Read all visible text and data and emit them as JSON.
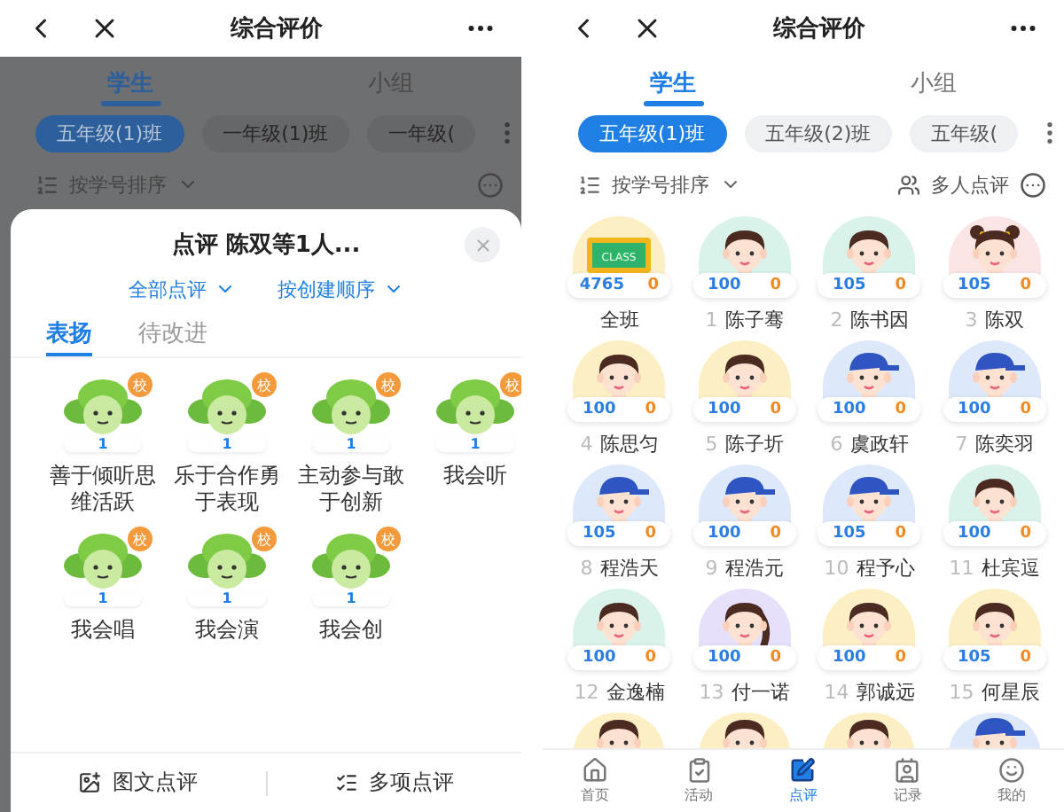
{
  "left_screen": {
    "title": "综合评价",
    "tabs": [
      {
        "label": "学生",
        "selected": true
      },
      {
        "label": "小组",
        "selected": false
      }
    ],
    "class_chips": [
      {
        "label": "五年级(1)班",
        "selected": true
      },
      {
        "label": "一年级(1)班",
        "selected": false
      },
      {
        "label": "一年级(",
        "selected": false
      }
    ],
    "sort_label": "按学号排序",
    "sheet": {
      "title": "点评 陈双等1人...",
      "filters": [
        "全部点评",
        "按创建顺序"
      ],
      "tabs": [
        {
          "label": "表扬",
          "selected": true
        },
        {
          "label": "待改进",
          "selected": false
        }
      ],
      "items": [
        {
          "label": "善于倾听思维活跃",
          "badge": "校",
          "count": "1"
        },
        {
          "label": "乐于合作勇于表现",
          "badge": "校",
          "count": "1"
        },
        {
          "label": "主动参与敢于创新",
          "badge": "校",
          "count": "1"
        },
        {
          "label": "我会听",
          "badge": "校",
          "count": "1"
        },
        {
          "label": "我会唱",
          "badge": "校",
          "count": "1"
        },
        {
          "label": "我会演",
          "badge": "校",
          "count": "1"
        },
        {
          "label": "我会创",
          "badge": "校",
          "count": "1"
        }
      ],
      "actions": [
        "图文点评",
        "多项点评"
      ]
    }
  },
  "right_screen": {
    "title": "综合评价",
    "tabs": [
      {
        "label": "学生",
        "selected": true
      },
      {
        "label": "小组",
        "selected": false
      }
    ],
    "class_chips": [
      {
        "label": "五年级(1)班",
        "selected": true
      },
      {
        "label": "五年级(2)班",
        "selected": false
      },
      {
        "label": "五年级(",
        "selected": false
      }
    ],
    "sort_label": "按学号排序",
    "multi_label": "多人点评",
    "students": [
      {
        "name": "全班",
        "score": "4765",
        "minus": "0",
        "kind": "class",
        "board_text": "CLASS",
        "color": "#fcefc4"
      },
      {
        "number": "1",
        "name": "陈子骞",
        "score": "100",
        "minus": "0",
        "kind": "boy",
        "color": "#d9f3ea"
      },
      {
        "number": "2",
        "name": "陈书因",
        "score": "105",
        "minus": "0",
        "kind": "boy",
        "color": "#d9f3ea"
      },
      {
        "number": "3",
        "name": "陈双",
        "score": "105",
        "minus": "0",
        "kind": "girl",
        "color": "#fbe4e4"
      },
      {
        "number": "4",
        "name": "陈思匀",
        "score": "100",
        "minus": "0",
        "kind": "boy",
        "color": "#fcefc4"
      },
      {
        "number": "5",
        "name": "陈子圻",
        "score": "100",
        "minus": "0",
        "kind": "boy",
        "color": "#fcefc4"
      },
      {
        "number": "6",
        "name": "虞政轩",
        "score": "100",
        "minus": "0",
        "kind": "cap",
        "color": "#dde9fb"
      },
      {
        "number": "7",
        "name": "陈奕羽",
        "score": "100",
        "minus": "0",
        "kind": "cap",
        "color": "#dde9fb"
      },
      {
        "number": "8",
        "name": "程浩天",
        "score": "105",
        "minus": "0",
        "kind": "cap",
        "color": "#dde9fb"
      },
      {
        "number": "9",
        "name": "程浩元",
        "score": "100",
        "minus": "0",
        "kind": "cap",
        "color": "#dde9fb"
      },
      {
        "number": "10",
        "name": "程予心",
        "score": "105",
        "minus": "0",
        "kind": "cap",
        "color": "#dde9fb"
      },
      {
        "number": "11",
        "name": "杜宾逗",
        "score": "100",
        "minus": "0",
        "kind": "boy",
        "color": "#d9f3ea"
      },
      {
        "number": "12",
        "name": "金逸楠",
        "score": "100",
        "minus": "0",
        "kind": "boy",
        "color": "#d9f3ea"
      },
      {
        "number": "13",
        "name": "付一诺",
        "score": "100",
        "minus": "0",
        "kind": "ponytail",
        "color": "#e6e0fa"
      },
      {
        "number": "14",
        "name": "郭诚远",
        "score": "100",
        "minus": "0",
        "kind": "boy",
        "color": "#fcefc4"
      },
      {
        "number": "15",
        "name": "何星辰",
        "score": "105",
        "minus": "0",
        "kind": "boy",
        "color": "#fcefc4"
      }
    ],
    "peek": [
      {
        "kind": "boy",
        "color": "#fcefc4"
      },
      {
        "kind": "boy",
        "color": "#fcefc4"
      },
      {
        "kind": "boy",
        "color": "#fcefc4"
      },
      {
        "kind": "cap",
        "color": "#dde9fb"
      }
    ],
    "nav": [
      {
        "label": "首页",
        "selected": false
      },
      {
        "label": "活动",
        "selected": false
      },
      {
        "label": "点评",
        "selected": true
      },
      {
        "label": "记录",
        "selected": false
      },
      {
        "label": "我的",
        "selected": false
      }
    ]
  }
}
